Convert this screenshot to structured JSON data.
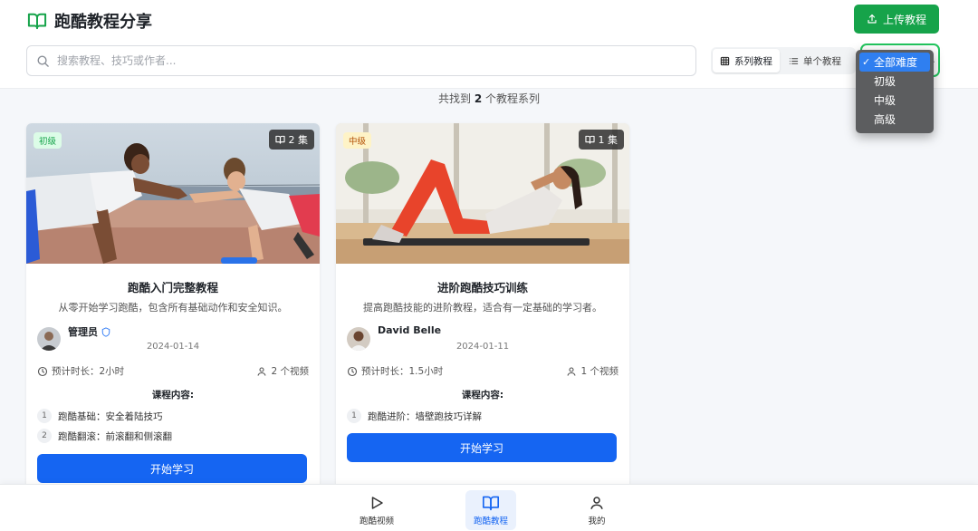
{
  "header": {
    "title": "跑酷教程分享",
    "upload_label": "上传教程"
  },
  "search": {
    "placeholder": "搜索教程、技巧或作者...",
    "value": ""
  },
  "view_toggle": {
    "series_label": "系列教程",
    "single_label": "单个教程",
    "active": "series"
  },
  "difficulty_filter": {
    "selected": "全部难度",
    "options": [
      "全部难度",
      "初级",
      "中级",
      "高级"
    ]
  },
  "results": {
    "prefix": "共找到",
    "count": "2",
    "suffix": "个教程系列"
  },
  "cards": [
    {
      "level": "初级",
      "level_color": "#16a34a",
      "level_bg": "#dcfce7",
      "episodes": "2 集",
      "title": "跑酷入门完整教程",
      "description": "从零开始学习跑酷，包含所有基础动作和安全知识。",
      "author": "管理员",
      "verified": true,
      "date": "2024-01-14",
      "duration": "预计时长：2小时",
      "videos": "2 个视频",
      "content_label": "课程内容:",
      "lessons": [
        {
          "num": "1",
          "title": "跑酷基础：安全着陆技巧"
        },
        {
          "num": "2",
          "title": "跑酷翻滚：前滚翻和侧滚翻"
        }
      ],
      "button": "开始学习"
    },
    {
      "level": "中级",
      "level_color": "#b45309",
      "level_bg": "#fef3c7",
      "episodes": "1 集",
      "title": "进阶跑酷技巧训练",
      "description": "提高跑酷技能的进阶教程，适合有一定基础的学习者。",
      "author": "David Belle",
      "verified": false,
      "date": "2024-01-11",
      "duration": "预计时长：1.5小时",
      "videos": "1 个视频",
      "content_label": "课程内容:",
      "lessons": [
        {
          "num": "1",
          "title": "跑酷进阶：墙壁跑技巧详解"
        }
      ],
      "button": "开始学习"
    }
  ],
  "bottom_nav": {
    "items": [
      "跑酷视频",
      "跑酷教程",
      "我的"
    ],
    "active": "跑酷教程"
  },
  "colors": {
    "brand_green": "#16a34a",
    "primary_blue": "#1565f2"
  }
}
